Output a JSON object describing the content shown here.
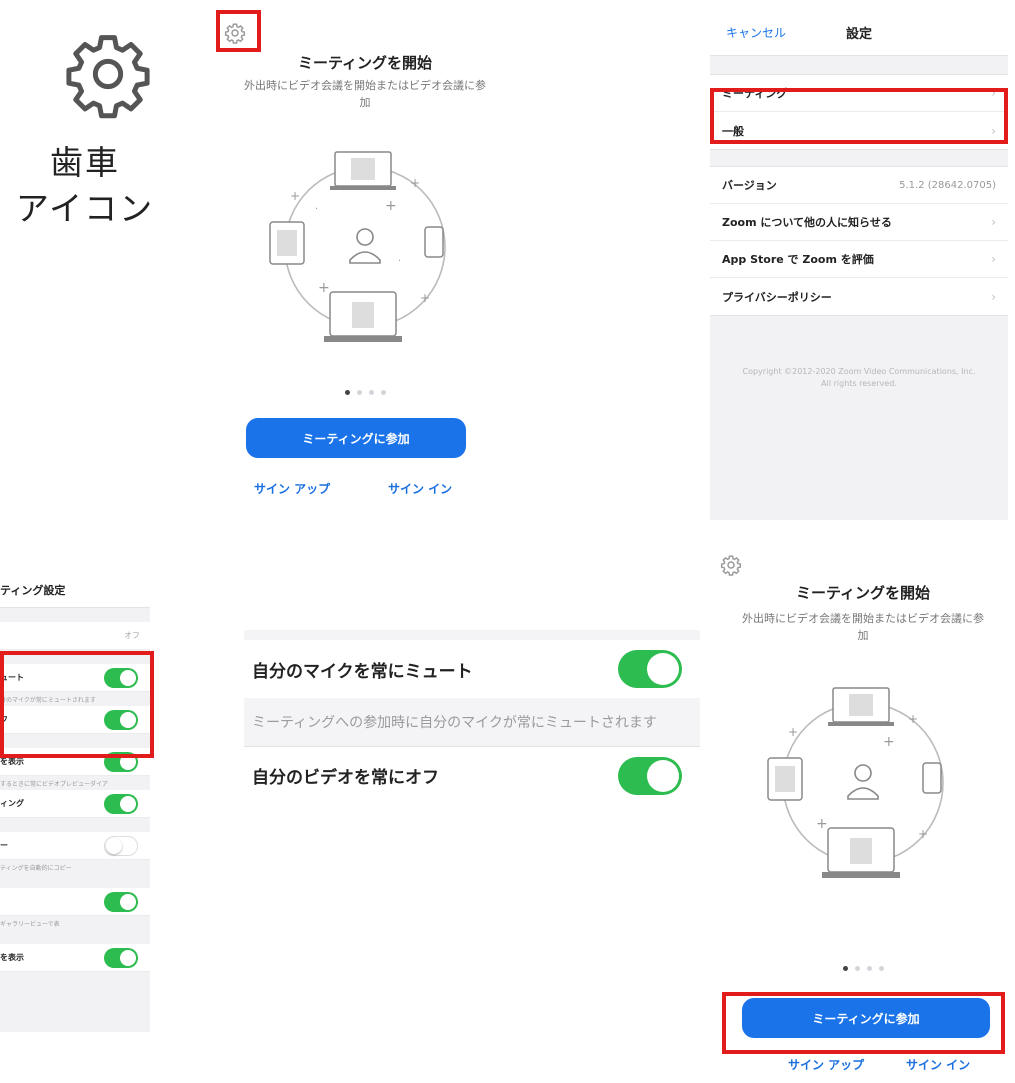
{
  "gear_caption": {
    "line1": "歯車",
    "line2": "アイコン"
  },
  "start_panel": {
    "title": "ミーティングを開始",
    "subtitle_line1": "外出時にビデオ会議を開始またはビデオ会議に参",
    "subtitle_line2": "加",
    "join_button": "ミーティングに参加",
    "signup": "サイン アップ",
    "signin": "サイン イン",
    "page_indicator": {
      "pages": 4,
      "current": 1
    }
  },
  "settings": {
    "cancel": "キャンセル",
    "title": "設定",
    "group1": [
      {
        "label": "ミーティング"
      },
      {
        "label": "一般"
      }
    ],
    "group2": [
      {
        "label": "バージョン",
        "value": "5.1.2 (28642.0705)"
      },
      {
        "label": "Zoom について他の人に知らせる"
      },
      {
        "label": "App Store で Zoom を評価"
      },
      {
        "label": "プライバシーポリシー"
      }
    ],
    "copyright_line1": "Copyright ©2012-2020 Zoom Video Communications, Inc.",
    "copyright_line2": "All rights reserved."
  },
  "meeting_settings": {
    "title": "ティング設定",
    "rows": [
      {
        "label": "",
        "value": "オフ",
        "desc": ""
      },
      {
        "label": "ュート",
        "switch": "on",
        "desc": "分のマイクが常にミュートされます"
      },
      {
        "label": "フ",
        "switch": "on",
        "desc": ""
      },
      {
        "label": "を表示",
        "switch": "on",
        "desc": "するときに常にビデオプレビューダイア"
      },
      {
        "label": "ィング",
        "switch": "on",
        "desc": ""
      },
      {
        "label": "ー",
        "switch": "off",
        "desc": "ティングを自動的にコピー"
      },
      {
        "label": "",
        "switch": "on",
        "desc": "ギャラリービューで表"
      },
      {
        "label": "を表示",
        "switch": "on",
        "desc": ""
      }
    ]
  },
  "zoom_settings": {
    "mute_label": "自分のマイクを常にミュート",
    "mute_desc": "ミーティングへの参加時に自分のマイクが常にミュートされます",
    "video_label": "自分のビデオを常にオフ",
    "mute_on": true,
    "video_on": true
  },
  "colors": {
    "accent": "#1a73e8",
    "switch_on": "#2cbc4f",
    "highlight": "#e21b1b"
  }
}
